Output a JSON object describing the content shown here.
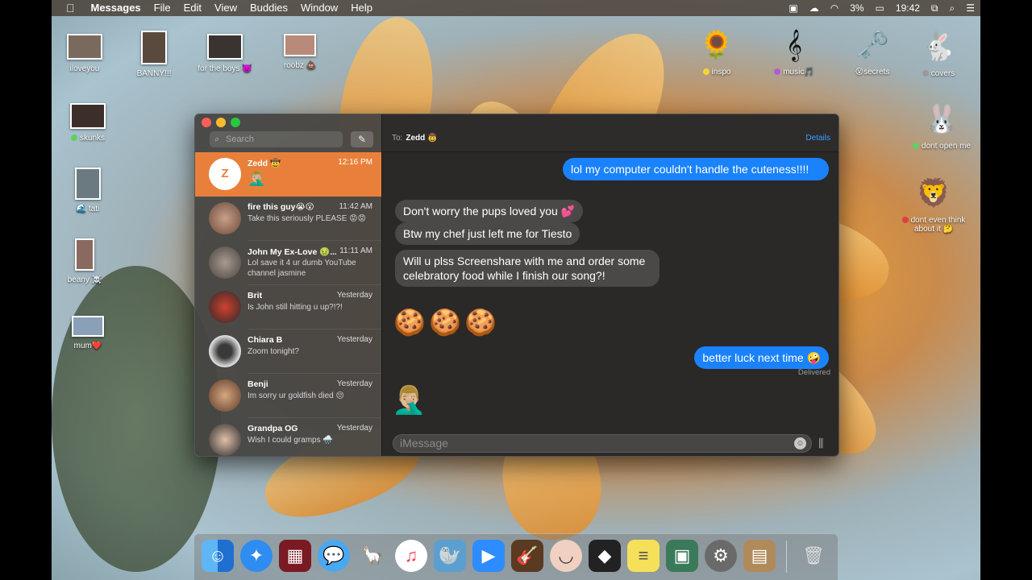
{
  "menubar": {
    "apple": "",
    "app": "Messages",
    "items": [
      "File",
      "Edit",
      "View",
      "Buddies",
      "Window",
      "Help"
    ],
    "battery": "3%",
    "time": "19:42"
  },
  "desktop_icons": [
    {
      "label": "iloveyou"
    },
    {
      "label": "BANNY!!!"
    },
    {
      "label": "for the boys 👿"
    },
    {
      "label": "roobz 💩"
    },
    {
      "label": "inspo"
    },
    {
      "label": "music🎵"
    },
    {
      "label": "😮secrets"
    },
    {
      "label": "covers"
    },
    {
      "label": "skunks"
    },
    {
      "label": "🌊 tati"
    },
    {
      "label": "beany ☠️"
    },
    {
      "label": "mum❤️"
    },
    {
      "label": "dont open me"
    },
    {
      "label": "dont even think about it 🤔"
    }
  ],
  "window": {
    "search_placeholder": "Search",
    "conversations": [
      {
        "initial": "Z",
        "name": "Zedd 🤠",
        "time": "12:16 PM",
        "preview": "🤦🏼‍♂️"
      },
      {
        "name": "fire this guy😭😮",
        "time": "11:42 AM",
        "preview": "Take this seriously PLEASE 😡😡"
      },
      {
        "name": "John My Ex-Love 🤢...",
        "time": "11:11 AM",
        "preview": "Lol save it 4 ur dumb YouTube channel jasmine"
      },
      {
        "name": "Brit",
        "time": "Yesterday",
        "preview": "Is John still hitting u up?!?!"
      },
      {
        "name": "Chiara B",
        "time": "Yesterday",
        "preview": "Zoom tonight?"
      },
      {
        "name": "Benji",
        "time": "Yesterday",
        "preview": "Im sorry ur goldfish died 😔"
      },
      {
        "name": "Grandpa OG",
        "time": "Yesterday",
        "preview": "Wish I could gramps 🌧️"
      }
    ],
    "chat": {
      "to_label": "To:",
      "recipient": "Zedd 🤠",
      "details": "Details",
      "messages": [
        {
          "dir": "out",
          "text": "lol my computer couldn't handle the cuteness!!!!"
        },
        {
          "dir": "in",
          "text": "Don't worry the pups loved you 💕"
        },
        {
          "dir": "in",
          "text": "Btw my chef just left me for Tiesto"
        },
        {
          "dir": "in",
          "text": "Will u plss Screenshare with me and order some celebratory food while I finish our song?!"
        },
        {
          "dir": "in",
          "text": "🍪"
        },
        {
          "dir": "in",
          "text": "🍪"
        },
        {
          "dir": "in",
          "text": "🍪"
        },
        {
          "dir": "out",
          "text": "better luck next time 🤪"
        },
        {
          "dir": "in",
          "text": "🤦🏼‍♂️"
        }
      ],
      "status": "Delivered",
      "input_placeholder": "iMessage"
    }
  },
  "dock": {
    "apps": [
      "finder-icon",
      "safari-icon",
      "photo-booth-icon",
      "messages-icon",
      "sidekick-icon",
      "music-icon",
      "walrus-icon",
      "zoom-icon",
      "garageband-icon",
      "face-icon",
      "photo-icon",
      "stickies-icon",
      "preview-icon",
      "system-preferences-icon",
      "contacts-icon",
      "trash-icon"
    ]
  }
}
